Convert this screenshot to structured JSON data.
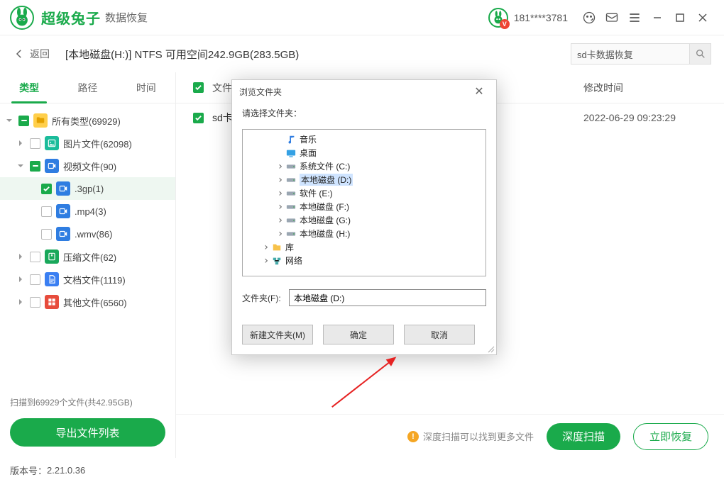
{
  "app": {
    "title": "超级兔子",
    "subtitle": "数据恢复",
    "phone": "181****3781"
  },
  "header": {
    "back": "返回",
    "disk_line": "[本地磁盘(H:)] NTFS 可用空间242.9GB(283.5GB)",
    "search_value": "sd卡数据恢复"
  },
  "tabs": {
    "type": "类型",
    "path": "路径",
    "time": "时间"
  },
  "tree": {
    "all": "所有类型(69929)",
    "img": "图片文件(62098)",
    "vid": "视频文件(90)",
    "v3gp": ".3gp(1)",
    "vmp4": ".mp4(3)",
    "vwmv": ".wmv(86)",
    "zip": "压缩文件(62)",
    "doc": "文档文件(1119)",
    "oth": "其他文件(6560)"
  },
  "side_foot": {
    "scan_info": "扫描到69929个文件(共42.95GB)",
    "export": "导出文件列表"
  },
  "list": {
    "head_name": "文件",
    "head_time": "修改时间",
    "rows": [
      {
        "name": "sd卡",
        "time": "2022-06-29 09:23:29"
      }
    ]
  },
  "bottom": {
    "tip": "深度扫描可以找到更多文件",
    "deep": "深度扫描",
    "recover": "立即恢复"
  },
  "footer": {
    "version_label": "版本号：",
    "version": "2.21.0.36"
  },
  "dialog": {
    "title": "浏览文件夹",
    "prompt": "请选择文件夹：",
    "folder_label": "文件夹(F):",
    "folder_value": "本地磁盘 (D:)",
    "btn_new": "新建文件夹(M)",
    "btn_ok": "确定",
    "btn_cancel": "取消",
    "items": {
      "music": "音乐",
      "desktop": "桌面",
      "sysc": "系统文件 (C:)",
      "d": "本地磁盘 (D:)",
      "e": "软件 (E:)",
      "f": "本地磁盘 (F:)",
      "g": "本地磁盘 (G:)",
      "h": "本地磁盘 (H:)",
      "lib": "库",
      "net": "网络"
    }
  }
}
